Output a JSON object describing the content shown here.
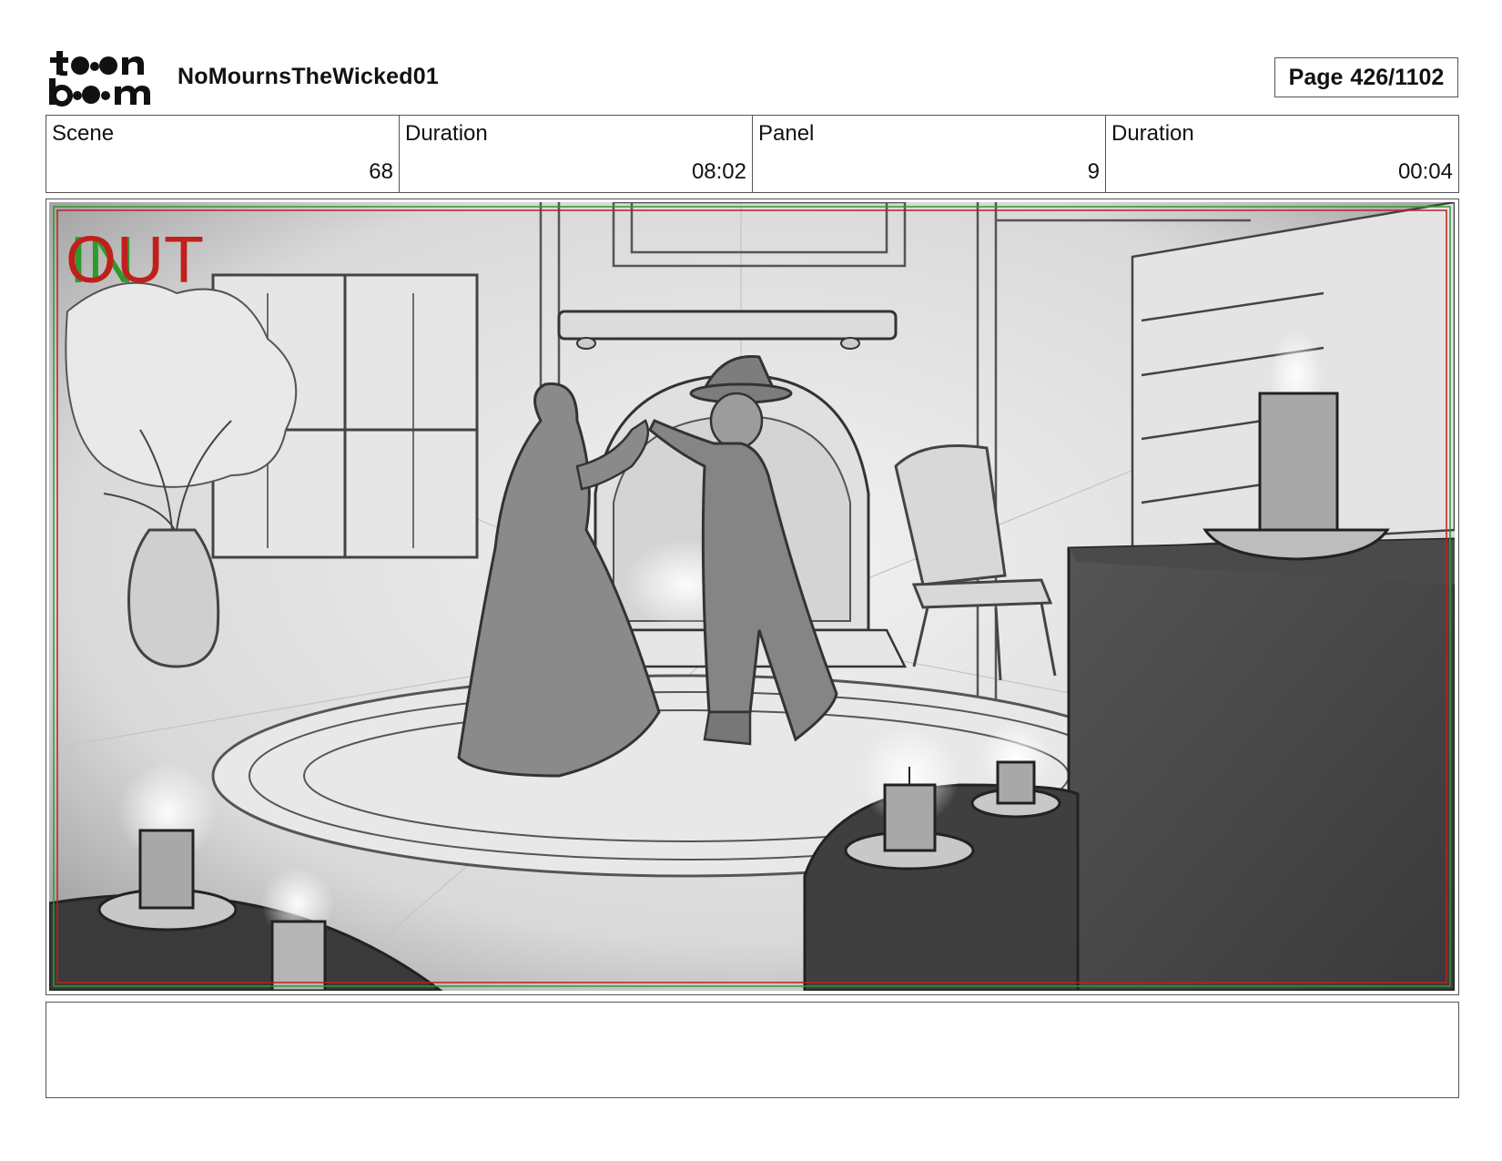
{
  "header": {
    "logo_text": "toon boom",
    "project_title": "NoMournsTheWicked01",
    "page_label": "Page",
    "page_number": "426/1102"
  },
  "info": {
    "scene_label": "Scene",
    "scene_value": "68",
    "scene_duration_label": "Duration",
    "scene_duration_value": "08:02",
    "panel_label": "Panel",
    "panel_value": "9",
    "panel_duration_label": "Duration",
    "panel_duration_value": "00:04"
  },
  "panel": {
    "transition_in": "IN",
    "transition_out": "OUT",
    "in_color": "#2e9a2e",
    "out_color": "#c0201c"
  },
  "dialogue": {
    "text": ""
  }
}
